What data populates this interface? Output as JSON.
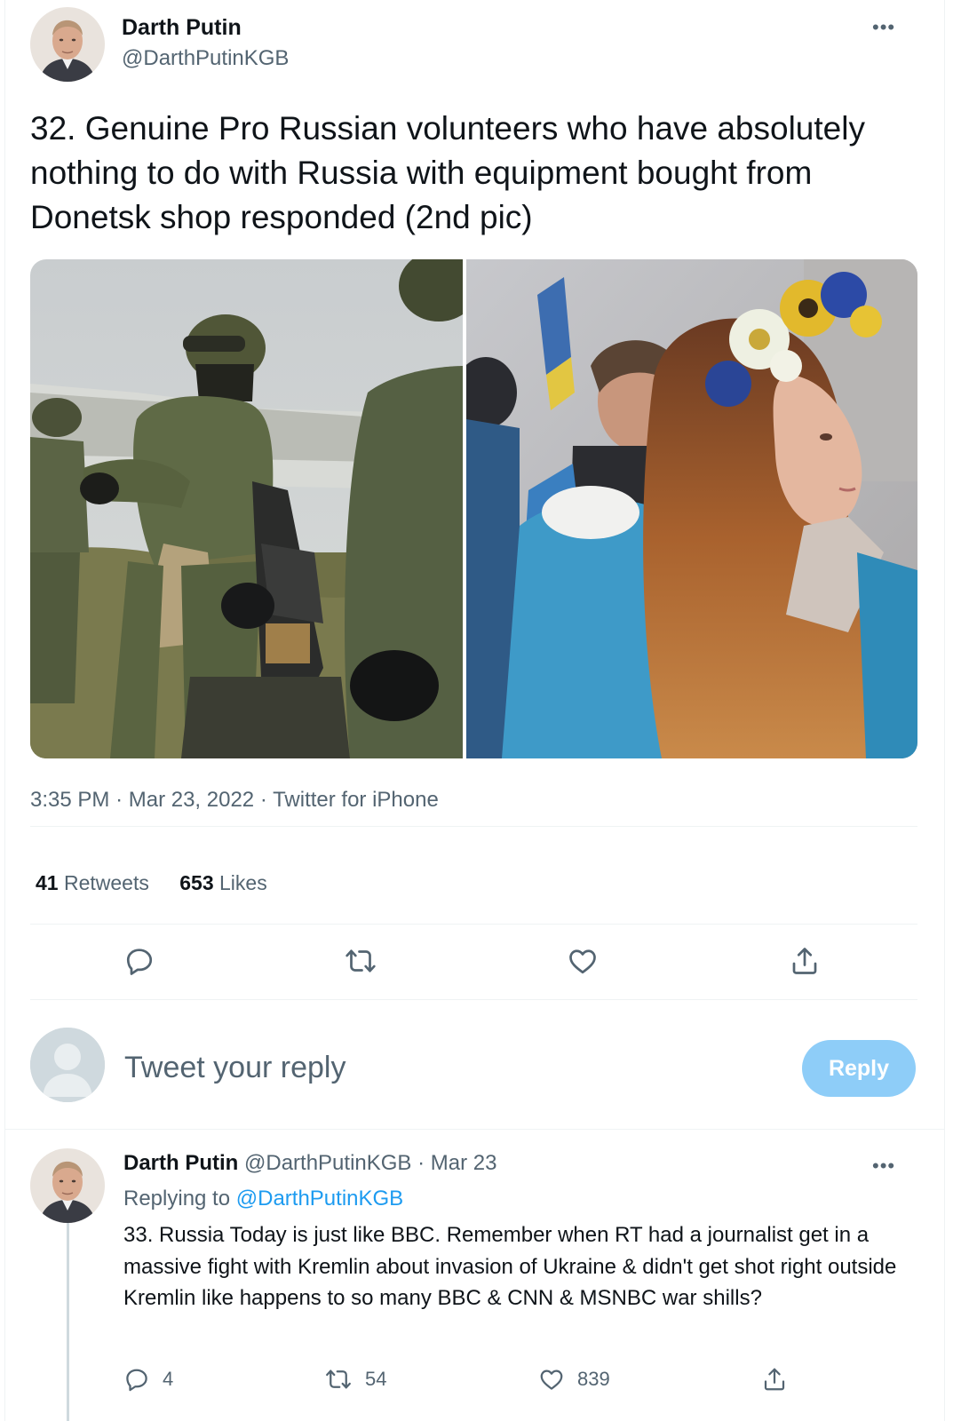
{
  "main_tweet": {
    "author": {
      "name": "Darth Putin",
      "handle": "@DarthPutinKGB"
    },
    "more_icon": "ellipsis-icon",
    "text": "32. Genuine Pro Russian volunteers who have absolutely nothing to do with Russia with equipment bought from Donetsk shop responded (2nd pic)",
    "media": [
      {
        "icon": "photo-soldiers",
        "alt": ""
      },
      {
        "icon": "photo-woman-flower-crown",
        "alt": ""
      }
    ],
    "time": "3:35 PM",
    "date": "Mar 23, 2022",
    "source": "Twitter for iPhone",
    "separator": "·",
    "stats": {
      "retweets_count": "41",
      "retweets_label": "Retweets",
      "likes_count": "653",
      "likes_label": "Likes"
    },
    "actions": [
      "reply-icon",
      "retweet-icon",
      "like-icon",
      "share-icon"
    ]
  },
  "reply_box": {
    "placeholder": "Tweet your reply",
    "button_label": "Reply"
  },
  "reply_tweet": {
    "author": {
      "name": "Darth Putin",
      "handle": "@DarthPutinKGB"
    },
    "separator": " · ",
    "date": "Mar 23",
    "replying_prefix": "Replying to ",
    "replying_handle": "@DarthPutinKGB",
    "text": "33. Russia Today is just like BBC. Remember when RT had a journalist get in a massive fight with Kremlin about invasion of Ukraine & didn't get shot right outside Kremlin like happens to so many BBC & CNN & MSNBC war shills?",
    "counts": {
      "replies": "4",
      "retweets": "54",
      "likes": "839"
    }
  },
  "colors": {
    "accent": "#1d9bf0",
    "reply_button": "#8ecdf8",
    "text": "#0f1419",
    "secondary": "#536471",
    "divider": "#eff3f4"
  }
}
